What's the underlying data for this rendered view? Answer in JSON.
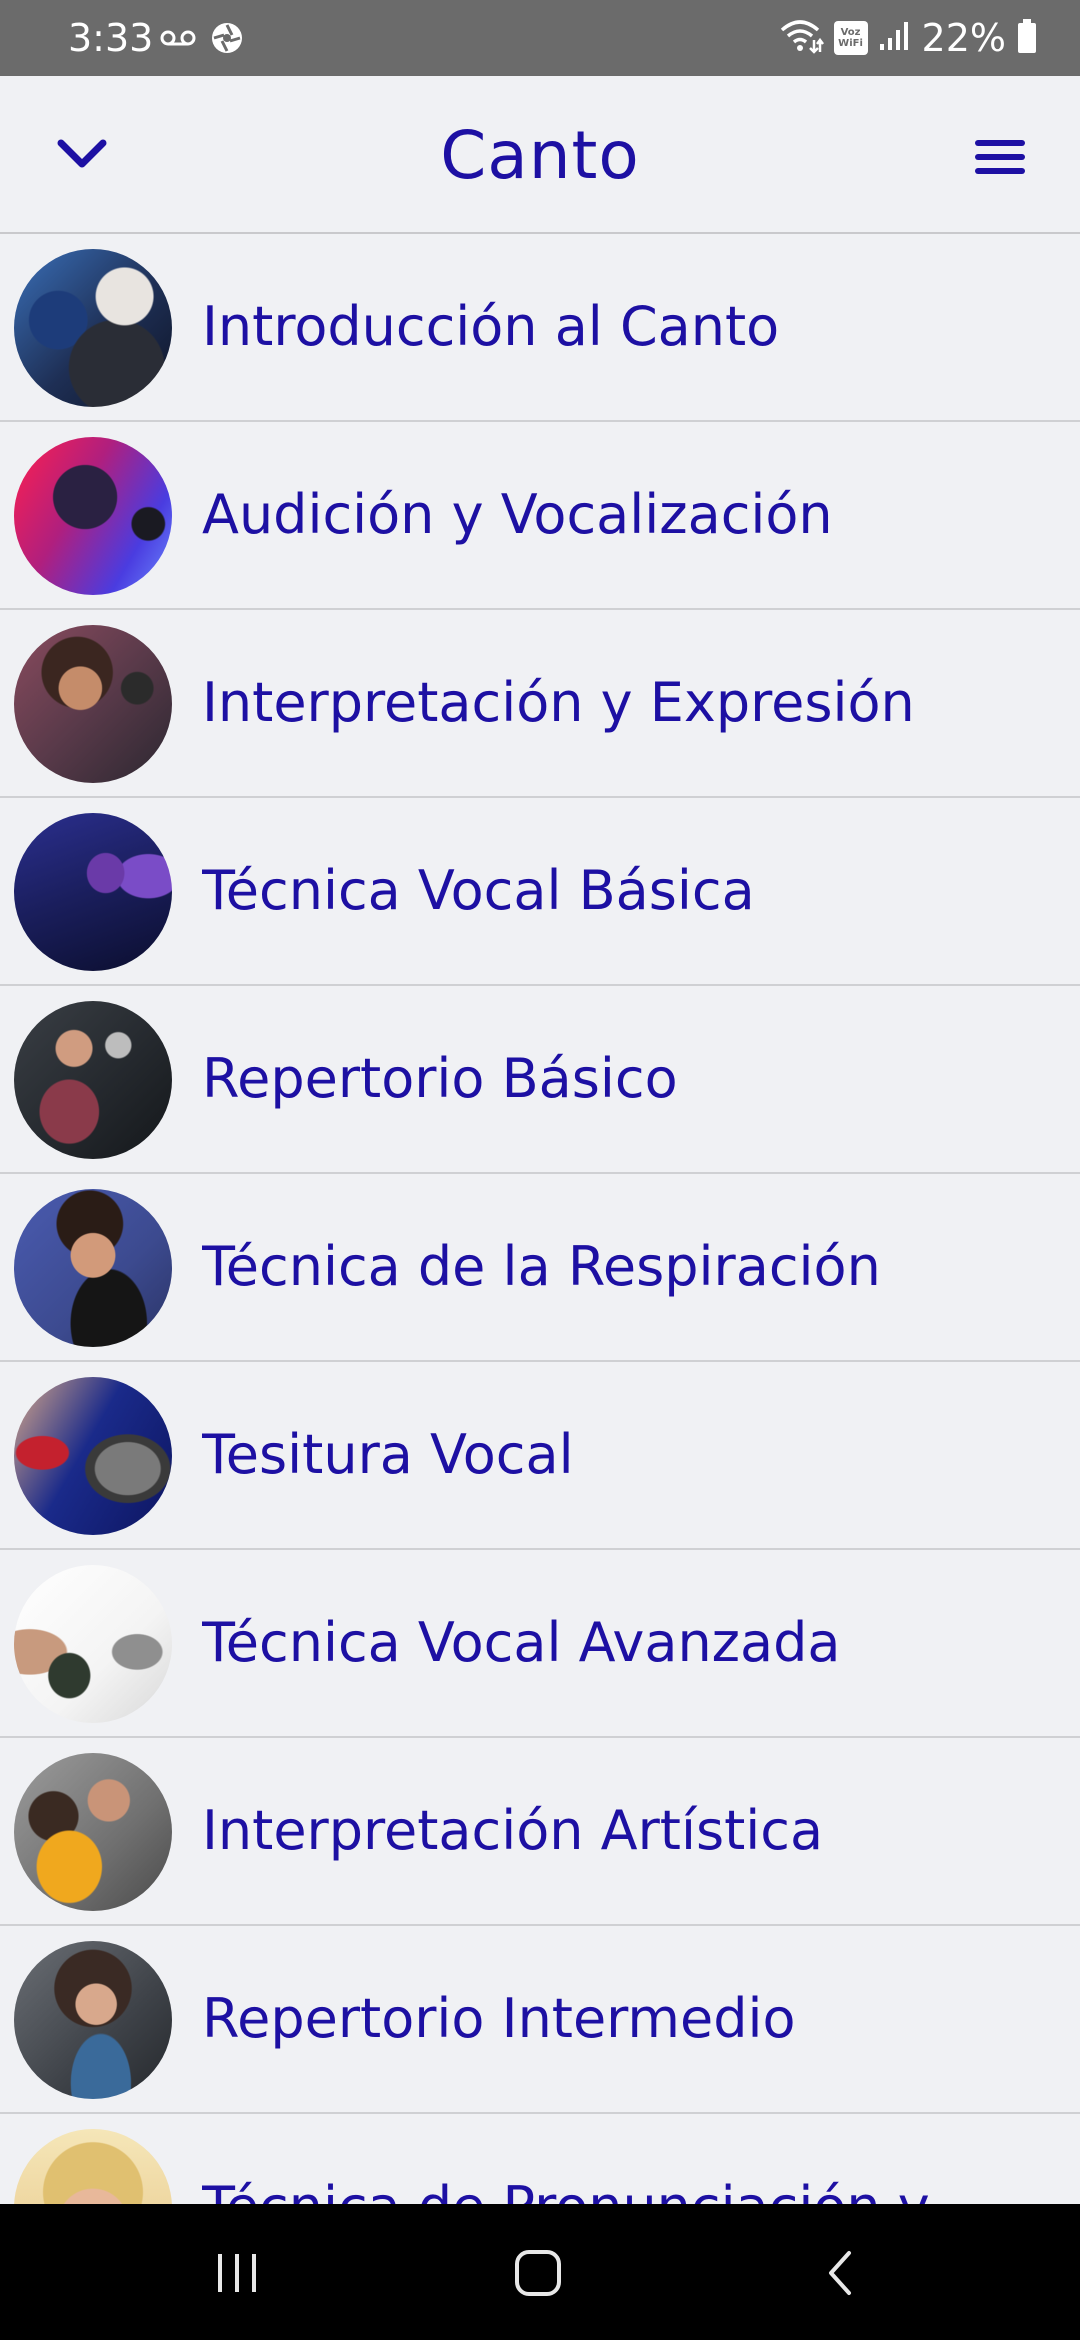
{
  "status_bar": {
    "time": "3:33",
    "voicemail_icon": "voicemail-icon",
    "app_icon": "aperture-icon",
    "wifi_icon": "wifi-calling-icon",
    "volte_label": "Voz WiFi",
    "signal_icon": "signal-icon",
    "battery_percent": "22%",
    "battery_level": 0.22
  },
  "header": {
    "title": "Canto",
    "back_icon": "chevron-down-icon",
    "menu_icon": "hamburger-menu-icon"
  },
  "courses": [
    {
      "title": "Introducción al Canto"
    },
    {
      "title": "Audición y Vocalización"
    },
    {
      "title": "Interpretación y Expresión"
    },
    {
      "title": "Técnica Vocal Básica"
    },
    {
      "title": "Repertorio Básico"
    },
    {
      "title": "Técnica de la Respiración"
    },
    {
      "title": "Tesitura Vocal"
    },
    {
      "title": "Técnica Vocal Avanzada"
    },
    {
      "title": "Interpretación Artística"
    },
    {
      "title": "Repertorio Intermedio"
    },
    {
      "title": "Técnica de Pronunciación y"
    }
  ],
  "nav_bar": {
    "recents_icon": "recent-apps-icon",
    "home_icon": "home-icon",
    "back_icon": "back-icon"
  },
  "colors": {
    "accent": "#1d10a3",
    "background": "#f0f1f4",
    "status_bar": "#6b6b6b",
    "nav_bar": "#000000"
  }
}
